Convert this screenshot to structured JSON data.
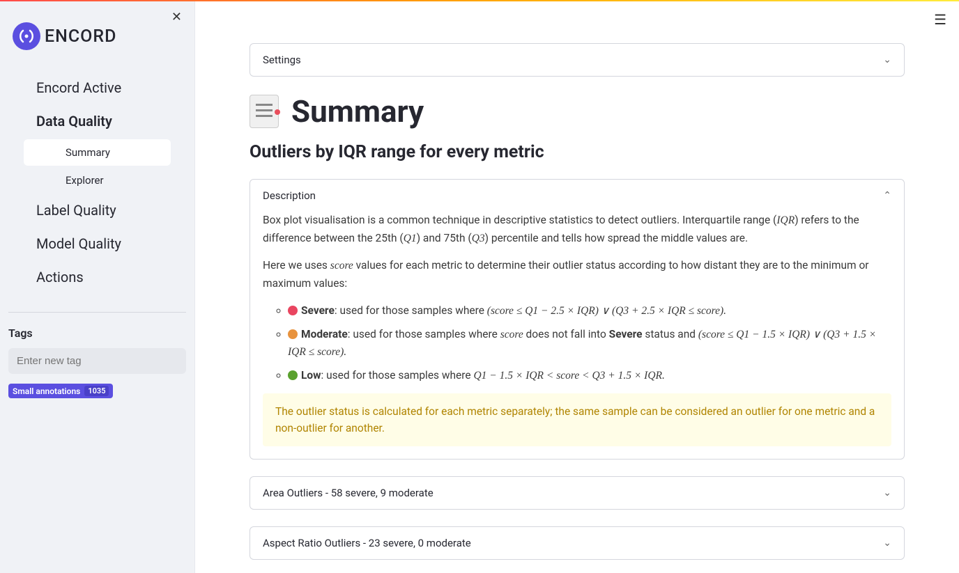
{
  "brand": {
    "name": "ENCORD"
  },
  "sidebar": {
    "items": [
      {
        "label": "Encord Active"
      },
      {
        "label": "Data Quality"
      },
      {
        "label": "Label Quality"
      },
      {
        "label": "Model Quality"
      },
      {
        "label": "Actions"
      }
    ],
    "subitems": [
      {
        "label": "Summary"
      },
      {
        "label": "Explorer"
      }
    ],
    "tags_title": "Tags",
    "tags_placeholder": "Enter new tag",
    "tag": {
      "label": "Small annotations",
      "count": "1035"
    }
  },
  "main": {
    "settings_label": "Settings",
    "page_title": "Summary",
    "subtitle": "Outliers by IQR range for every metric",
    "description_label": "Description",
    "p1_a": "Box plot visualisation is a common technique in descriptive statistics to detect outliers. Interquartile range (",
    "p1_iqr": "IQR",
    "p1_b": ") refers to the difference between the 25th (",
    "p1_q1": "Q1",
    "p1_c": ") and 75th (",
    "p1_q3": "Q3",
    "p1_d": ") percentile and tells how spread the middle values are.",
    "p2_a": "Here we uses ",
    "p2_score": "score",
    "p2_b": " values for each metric to determine their outlier status according to how distant they are to the minimum or maximum values:",
    "severe_label": "Severe",
    "severe_text": ": used for those samples where ",
    "severe_formula": "(score ≤ Q1 − 2.5 × IQR) ∨ (Q3 + 2.5 × IQR ≤ score).",
    "moderate_label": "Moderate",
    "moderate_text_a": ": used for those samples where ",
    "moderate_score": "score",
    "moderate_text_b": " does not fall into ",
    "moderate_severe": "Severe",
    "moderate_text_c": " status and ",
    "moderate_formula": "(score ≤ Q1 − 1.5 × IQR) ∨ (Q3 + 1.5 × IQR ≤ score).",
    "low_label": "Low",
    "low_text": ": used for those samples where ",
    "low_formula": "Q1 − 1.5 × IQR < score < Q3 + 1.5 × IQR.",
    "note": "The outlier status is calculated for each metric separately; the same sample can be considered an outlier for one metric and a non-outlier for another.",
    "panels": [
      {
        "label": "Area Outliers - 58 severe, 9 moderate"
      },
      {
        "label": "Aspect Ratio Outliers - 23 severe, 0 moderate"
      }
    ]
  }
}
